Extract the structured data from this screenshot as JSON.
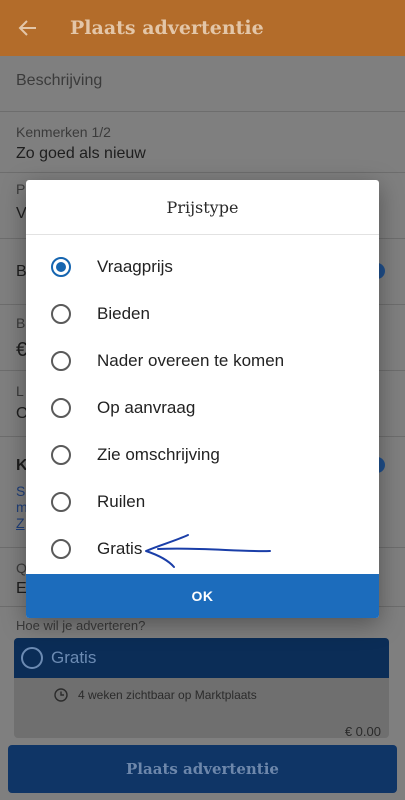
{
  "appbar": {
    "title": "Plaats advertentie",
    "back_icon": "arrow-left-icon"
  },
  "form": {
    "description_label": "Beschrijving",
    "features_label": "Kenmerken 1/2",
    "features_value": "Zo goed als nieuw",
    "partial": {
      "r3_label": "P",
      "r3_value": "V",
      "r4_label": "B",
      "r5_label": "B",
      "r5_value": "€",
      "r6_label": "L",
      "r6_value": "O",
      "r7_label": "K",
      "r7_line1": "S",
      "r7_line2": "m",
      "r7_line3": "Z",
      "r8_label": "Q",
      "r8_value": "E"
    },
    "advertise_question": "Hoe wil je adverteren?",
    "plan": {
      "name": "Gratis",
      "feature": "4 weken zichtbaar op Marktplaats",
      "price": "€ 0.00"
    },
    "submit_label": "Plaats advertentie"
  },
  "dialog": {
    "title": "Prijstype",
    "selected_index": 0,
    "options": [
      {
        "label": "Vraagprijs",
        "selected": true
      },
      {
        "label": "Bieden",
        "selected": false
      },
      {
        "label": "Nader overeen te komen",
        "selected": false
      },
      {
        "label": "Op aanvraag",
        "selected": false
      },
      {
        "label": "Zie omschrijving",
        "selected": false
      },
      {
        "label": "Ruilen",
        "selected": false
      },
      {
        "label": "Gratis",
        "selected": false
      }
    ],
    "ok_label": "OK"
  },
  "colors": {
    "brand_orange": "#b36c2a",
    "accent_blue": "#1c6cbc",
    "dark_navy": "#0f3566",
    "annotation_ink": "#1a3ea8"
  }
}
